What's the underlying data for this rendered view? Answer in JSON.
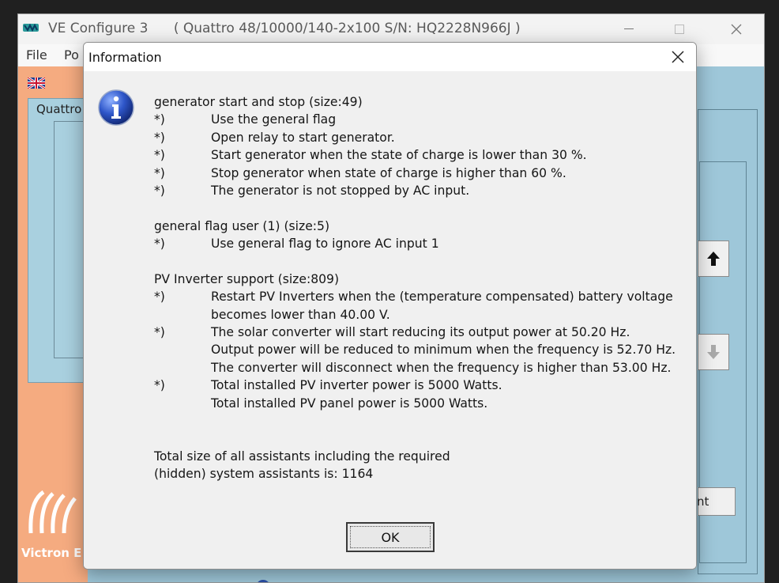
{
  "main_window": {
    "title": "VE Configure 3",
    "subtitle": "( Quattro 48/10000/140-2x100 S/N: HQ2228N966J )",
    "menu": [
      "File",
      "Po"
    ],
    "device_label": "Quattro",
    "brand_text": "Victron E",
    "behind_button_label": "nt"
  },
  "dialog": {
    "title": "Information",
    "sections": [
      {
        "heading": "generator start and stop (size:49)",
        "items": [
          {
            "marker": "*)",
            "text": "Use the general flag"
          },
          {
            "marker": "*)",
            "text": "Open relay to start generator."
          },
          {
            "marker": "*)",
            "text": "Start generator when the state of charge is lower than 30 %."
          },
          {
            "marker": "*)",
            "text": "Stop generator when state of charge is higher than 60 %."
          },
          {
            "marker": "*)",
            "text": "The generator is not stopped by AC input."
          }
        ]
      },
      {
        "heading": "general flag user (1) (size:5)",
        "items": [
          {
            "marker": "*)",
            "text": "Use general flag to ignore AC input 1"
          }
        ]
      },
      {
        "heading": "PV Inverter support (size:809)",
        "items": [
          {
            "marker": "*)",
            "text": "Restart PV Inverters when the (temperature compensated) battery voltage"
          },
          {
            "marker": "",
            "text": "becomes lower than 40.00 V."
          },
          {
            "marker": "*)",
            "text": "The solar converter will start reducing its output power at 50.20 Hz."
          },
          {
            "marker": "",
            "text": "Output power will be reduced to minimum when the frequency is  52.70 Hz."
          },
          {
            "marker": "",
            "text": "The converter will disconnect when the frequency is higher than  53.00 Hz."
          },
          {
            "marker": "*)",
            "text": "Total installed PV inverter power is 5000 Watts."
          },
          {
            "marker": "",
            "text": "Total installed PV panel power is 5000 Watts."
          }
        ]
      }
    ],
    "total_line1": "Total size of all assistants including the required",
    "total_line2": "(hidden) system assistants is: 1164",
    "ok_label": "OK"
  }
}
